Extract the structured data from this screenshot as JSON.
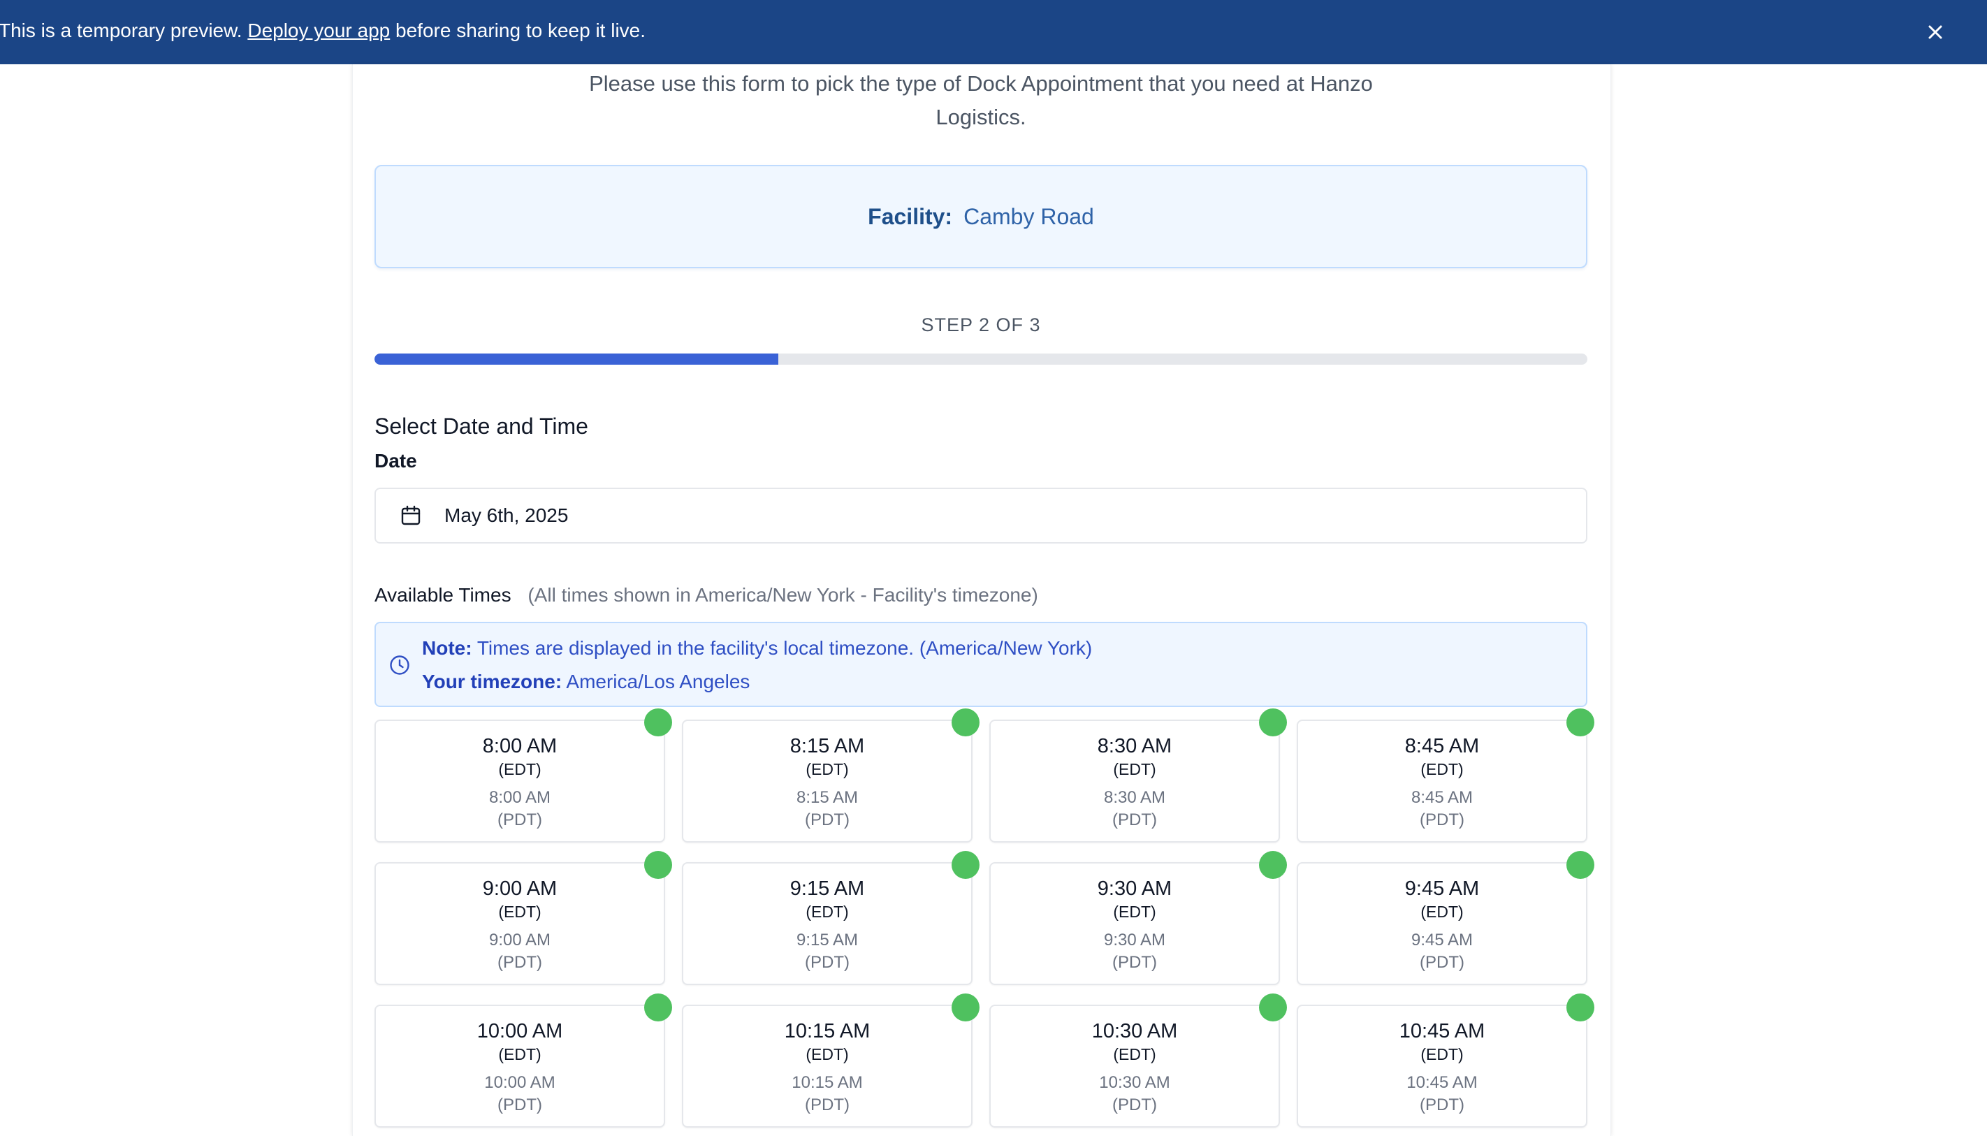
{
  "banner": {
    "prefix": "This is a temporary preview. ",
    "link": "Deploy your app",
    "suffix": " before sharing to keep it live."
  },
  "intro": "Please use this form to pick the type of Dock Appointment that you need at Hanzo Logistics.",
  "facility": {
    "label": "Facility:",
    "value": "Camby Road"
  },
  "step": {
    "text": "STEP 2 OF 3",
    "progress": 0.333
  },
  "form": {
    "title": "Select Date and Time",
    "date_label": "Date",
    "date_value": "May 6th, 2025"
  },
  "available": {
    "title": "Available Times",
    "note": "(All times shown in America/New York - Facility's timezone)"
  },
  "tz_note": {
    "note_label": "Note:",
    "note_text": " Times are displayed in the facility's local timezone. (America/New York)",
    "tz_label": "Your timezone:",
    "tz_text": " America/Los Angeles"
  },
  "slots": [
    {
      "time": "8:00 AM",
      "tz": "(EDT)",
      "local": "8:00 AM",
      "local_tz": "(PDT)"
    },
    {
      "time": "8:15 AM",
      "tz": "(EDT)",
      "local": "8:15 AM",
      "local_tz": "(PDT)"
    },
    {
      "time": "8:30 AM",
      "tz": "(EDT)",
      "local": "8:30 AM",
      "local_tz": "(PDT)"
    },
    {
      "time": "8:45 AM",
      "tz": "(EDT)",
      "local": "8:45 AM",
      "local_tz": "(PDT)"
    },
    {
      "time": "9:00 AM",
      "tz": "(EDT)",
      "local": "9:00 AM",
      "local_tz": "(PDT)"
    },
    {
      "time": "9:15 AM",
      "tz": "(EDT)",
      "local": "9:15 AM",
      "local_tz": "(PDT)"
    },
    {
      "time": "9:30 AM",
      "tz": "(EDT)",
      "local": "9:30 AM",
      "local_tz": "(PDT)"
    },
    {
      "time": "9:45 AM",
      "tz": "(EDT)",
      "local": "9:45 AM",
      "local_tz": "(PDT)"
    },
    {
      "time": "10:00 AM",
      "tz": "(EDT)",
      "local": "10:00 AM",
      "local_tz": "(PDT)"
    },
    {
      "time": "10:15 AM",
      "tz": "(EDT)",
      "local": "10:15 AM",
      "local_tz": "(PDT)"
    },
    {
      "time": "10:30 AM",
      "tz": "(EDT)",
      "local": "10:30 AM",
      "local_tz": "(PDT)"
    },
    {
      "time": "10:45 AM",
      "tz": "(EDT)",
      "local": "10:45 AM",
      "local_tz": "(PDT)"
    }
  ],
  "colors": {
    "banner": "#1b4586",
    "progress": "#3a62d6",
    "available_dot": "#4fc15f"
  },
  "icons": {
    "close": "close-icon",
    "calendar": "calendar-icon",
    "clock": "clock-icon",
    "availability": "availability-dot-icon"
  }
}
